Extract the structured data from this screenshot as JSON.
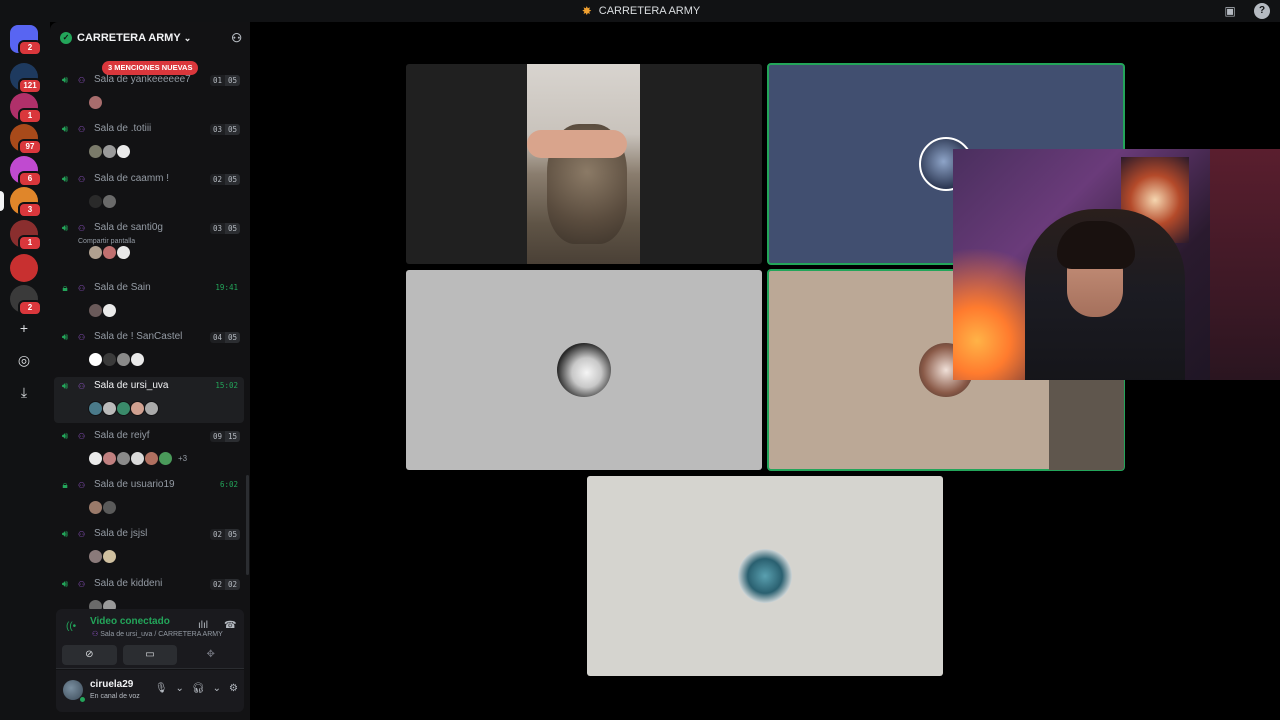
{
  "titlebar": {
    "title": "CARRETERA ARMY"
  },
  "rail": {
    "servers": [
      {
        "name": "direct-messages",
        "badge": "2",
        "color": "#5865f2"
      },
      {
        "name": "server-1",
        "badge": "121",
        "color": "#1e3a5f"
      },
      {
        "name": "server-2",
        "badge": "1",
        "color": "#b0306a"
      },
      {
        "name": "server-3",
        "badge": "97",
        "color": "#a84a1a"
      },
      {
        "name": "server-4",
        "badge": "6",
        "color": "#c04ad0"
      },
      {
        "name": "carretera-army",
        "badge": "3",
        "color": "#e0862a"
      },
      {
        "name": "server-6",
        "badge": "1",
        "color": "#8a2e2e"
      },
      {
        "name": "server-7",
        "badge": "",
        "color": "#c83030"
      },
      {
        "name": "server-8",
        "badge": "2",
        "color": "#3a3a3a"
      }
    ]
  },
  "guild": {
    "name": "CARRETERA ARMY",
    "mentions_pill": "3 MENCIONES NUEVAS"
  },
  "channels": [
    {
      "name": "Sala de yankeeeeee7",
      "users": "01",
      "limit": "05",
      "time": "",
      "sub": "",
      "more": "",
      "locked": false,
      "avatars": [
        "#a86d6d"
      ]
    },
    {
      "name": "Sala de .totiii",
      "users": "03",
      "limit": "05",
      "time": "",
      "sub": "",
      "more": "",
      "locked": false,
      "avatars": [
        "#7a7a6a",
        "#9a9a9a",
        "#eaeaea"
      ]
    },
    {
      "name": "Sala de caamm !",
      "users": "02",
      "limit": "05",
      "time": "",
      "sub": "",
      "more": "",
      "locked": false,
      "avatars": [
        "#2a2a2a",
        "#6a6a6a"
      ]
    },
    {
      "name": "Sala de santi0g",
      "users": "03",
      "limit": "05",
      "time": "",
      "sub": "Compartir pantalla",
      "more": "",
      "locked": false,
      "avatars": [
        "#b0a090",
        "#c07070",
        "#e8e8e8"
      ]
    },
    {
      "name": "Sala de Sain",
      "users": "",
      "limit": "",
      "time": "19:41",
      "sub": "",
      "more": "",
      "locked": true,
      "avatars": [
        "#6a5a5a",
        "#eaeaea"
      ]
    },
    {
      "name": "Sala de ! SanCastel",
      "users": "04",
      "limit": "05",
      "time": "",
      "sub": "",
      "more": "",
      "locked": false,
      "avatars": [
        "#ffffff",
        "#3a3a3a",
        "#8a8a8a",
        "#eaeaea"
      ]
    },
    {
      "name": "Sala de ursi_uva",
      "users": "",
      "limit": "",
      "time": "15:02",
      "sub": "",
      "more": "",
      "locked": false,
      "selected": true,
      "avatars": [
        "#4a7a8a",
        "#bababa",
        "#3a8a6a",
        "#d0a090",
        "#aaaaaa"
      ]
    },
    {
      "name": "Sala de reiyf",
      "users": "09",
      "limit": "15",
      "time": "",
      "sub": "",
      "more": "+3",
      "locked": false,
      "avatars": [
        "#eaeaea",
        "#c08080",
        "#8a8a8a",
        "#dadada",
        "#b07060",
        "#4a9a5a"
      ]
    },
    {
      "name": "Sala de usuario19",
      "users": "",
      "limit": "",
      "time": "6:02",
      "sub": "",
      "more": "",
      "locked": true,
      "avatars": [
        "#9a7a6a",
        "#5a5a5a"
      ]
    },
    {
      "name": "Sala de jsjsl",
      "users": "02",
      "limit": "05",
      "time": "",
      "sub": "",
      "more": "",
      "locked": false,
      "avatars": [
        "#8a7a7a",
        "#d0c0a0"
      ]
    },
    {
      "name": "Sala de kiddeni",
      "users": "02",
      "limit": "02",
      "time": "",
      "sub": "",
      "more": "",
      "locked": false,
      "avatars": [
        "#6a6a6a",
        "#9a9a9a"
      ]
    }
  ],
  "voice": {
    "status": "Video conectado",
    "location": "Sala de ursi_uva / CARRETERA ARMY"
  },
  "user": {
    "name": "ciruela29",
    "status": "En canal de voz"
  },
  "stage": {
    "tiles": [
      {
        "name": "tile-cat-video",
        "bg": "#202020",
        "speaking": false
      },
      {
        "name": "tile-participant-blue",
        "bg": "#414f70",
        "speaking": true
      },
      {
        "name": "tile-participant-gray",
        "bg": "#bbbbbb",
        "speaking": false
      },
      {
        "name": "tile-participant-beige",
        "bg": "#bba896",
        "speaking": true
      },
      {
        "name": "tile-participant-light",
        "bg": "#d5d4cf",
        "speaking": false
      }
    ]
  }
}
